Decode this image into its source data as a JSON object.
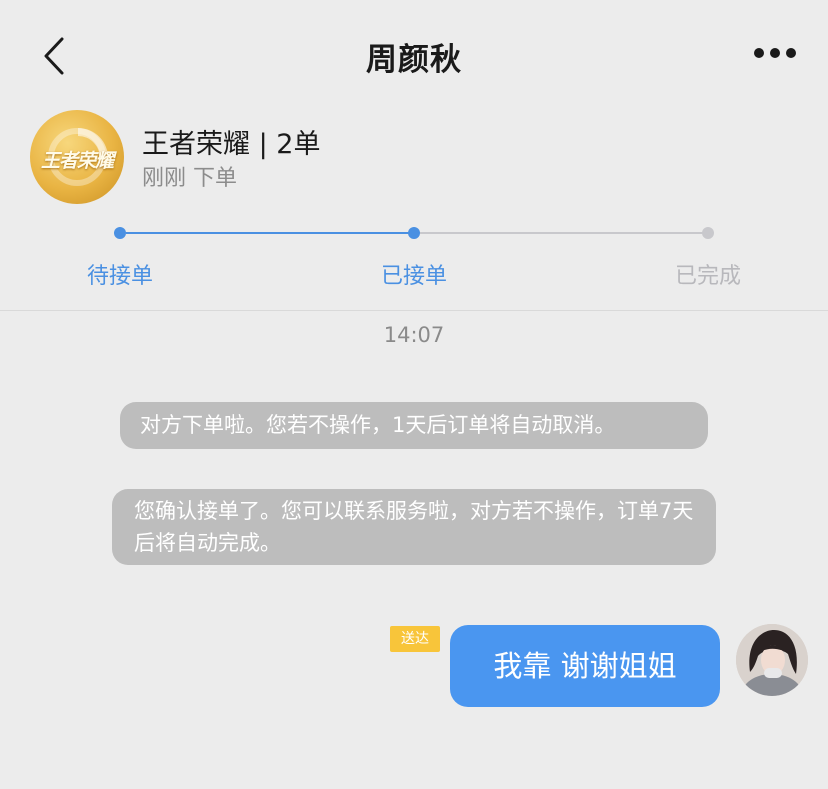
{
  "header": {
    "title": "周颜秋"
  },
  "order": {
    "game_logo_text": "王者荣耀",
    "title": "王者荣耀 | 2单",
    "subtitle": "刚刚 下单"
  },
  "progress": {
    "steps": [
      {
        "label": "待接单",
        "state": "done"
      },
      {
        "label": "已接单",
        "state": "current"
      },
      {
        "label": "已完成",
        "state": "pending"
      }
    ],
    "colors": {
      "active": "#4a90e2",
      "inactive": "#c8c8cc"
    }
  },
  "chat": {
    "timestamp": "14:07",
    "system_messages": [
      "对方下单啦。您若不操作，1天后订单将自动取消。",
      "您确认接单了。您可以联系服务啦，对方若不操作，订单7天后将自动完成。"
    ],
    "my_message": {
      "text": "我靠 谢谢姐姐",
      "status": "送达",
      "bubble_color": "#4a96f0"
    }
  }
}
